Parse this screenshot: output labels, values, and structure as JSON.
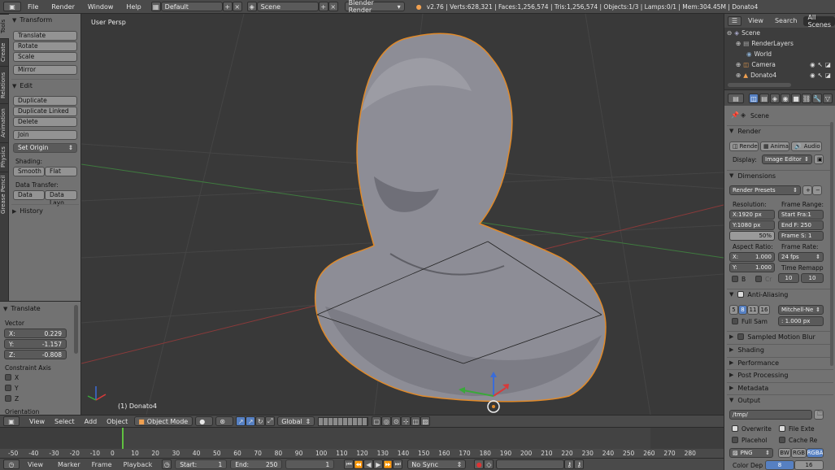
{
  "topbar": {
    "menus": [
      "File",
      "Render",
      "Window",
      "Help"
    ],
    "layout": "Default",
    "scene": "Scene",
    "engine": "Blender Render",
    "stats": "v2.76 | Verts:628,321 | Faces:1,256,574 | Tris:1,256,574 | Objects:1/3 | Lamps:0/1 | Mem:304.45M | Donato4"
  },
  "tabs": [
    "Tools",
    "Create",
    "Relations",
    "Animation",
    "Physics",
    "Grease Pencil"
  ],
  "toolshelf": {
    "transform_header": "Transform",
    "translate": "Translate",
    "rotate": "Rotate",
    "scale": "Scale",
    "mirror": "Mirror",
    "edit_header": "Edit",
    "duplicate": "Duplicate",
    "duplicate_linked": "Duplicate Linked",
    "delete": "Delete",
    "join": "Join",
    "set_origin": "Set Origin",
    "shading_label": "Shading:",
    "smooth": "Smooth",
    "flat": "Flat",
    "data_transfer_label": "Data Transfer:",
    "data": "Data",
    "data_layout": "Data Layo",
    "history_header": "History"
  },
  "operator": {
    "header": "Translate",
    "vector_label": "Vector",
    "x_label": "X:",
    "x_value": "0.229",
    "y_label": "Y:",
    "y_value": "-1.157",
    "z_label": "Z:",
    "z_value": "-0.808",
    "constraint_label": "Constraint Axis",
    "cx": "X",
    "cy": "Y",
    "cz": "Z",
    "orientation_label": "Orientation"
  },
  "viewport": {
    "view_name": "User Persp",
    "object_label": "(1) Donato4"
  },
  "vp_header": {
    "view": "View",
    "select": "Select",
    "add": "Add",
    "object": "Object",
    "mode": "Object Mode",
    "orientation": "Global"
  },
  "timeline": {
    "ticks": [
      "-50",
      "-40",
      "-30",
      "-20",
      "-10",
      "0",
      "10",
      "20",
      "30",
      "40",
      "50",
      "60",
      "70",
      "80",
      "90",
      "100",
      "110",
      "120",
      "130",
      "140",
      "150",
      "160",
      "170",
      "180",
      "190",
      "200",
      "210",
      "220",
      "230",
      "240",
      "250",
      "260",
      "270",
      "280"
    ],
    "menus": [
      "View",
      "Marker",
      "Frame",
      "Playback"
    ],
    "start": "Start:",
    "start_value": "1",
    "end": "End:",
    "end_value": "250",
    "current": "1",
    "sync": "No Sync"
  },
  "outliner": {
    "view": "View",
    "search": "Search",
    "all_scenes": "All Scenes",
    "items": [
      "Scene",
      "RenderLayers",
      "World",
      "Camera",
      "Donato4"
    ]
  },
  "props": {
    "scene": "Scene",
    "render_header": "Render",
    "render_btn": "Render",
    "anim_btn": "Animati",
    "audio_btn": "Audio",
    "display_label": "Display:",
    "display_value": "Image Editor",
    "dimensions_header": "Dimensions",
    "render_presets": "Render Presets",
    "resolution_label": "Resolution:",
    "res_x": "X:1920 px",
    "res_y": "Y:1080 px",
    "res_pct": "50%",
    "frame_range_label": "Frame Range:",
    "start_frame": "Start Fra:1",
    "end_frame": "End F: 250",
    "frame_step": "Frame S: 1",
    "aspect_label": "Aspect Ratio:",
    "asp_x_label": "X:",
    "asp_x": "1.000",
    "asp_y_label": "Y:",
    "asp_y": "1.000",
    "frame_rate_label": "Frame Rate:",
    "fps": "24 fps",
    "time_remap_label": "Time Remapp",
    "b_label": "B",
    "cr_label": "Cr",
    "remap_old": "10",
    "remap_new": "10",
    "aa_header": "Anti-Aliasing",
    "aa_5": "5",
    "aa_8": "8",
    "aa_11": "11",
    "aa_16": "16",
    "aa_filter": "Mitchell-Ne",
    "full_sample": "Full Sam",
    "filter_size": ": 1.000 px",
    "motion_blur": "Sampled Motion Blur",
    "shading": "Shading",
    "performance": "Performance",
    "post_processing": "Post Processing",
    "metadata": "Metadata",
    "output_header": "Output",
    "output_path": "/tmp/",
    "overwrite": "Overwrite",
    "file_ext": "File Exte",
    "placeholders": "Placehol",
    "cache_result": "Cache Re",
    "format": "PNG",
    "bw": "BW",
    "rgb": "RGB",
    "rgba": "RGBA",
    "color_depth_label": "Color Dep",
    "depth_8": "8",
    "depth_16": "16"
  }
}
